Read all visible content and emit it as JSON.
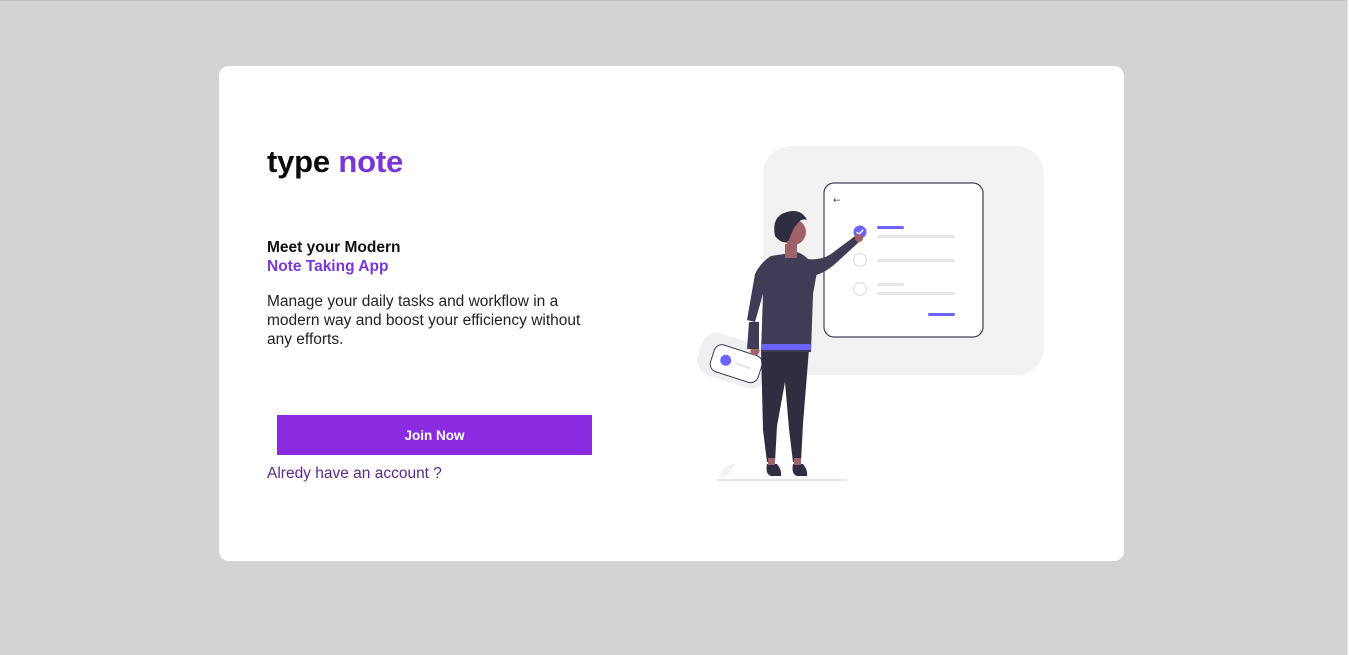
{
  "brand": {
    "word1": "type",
    "word2": "note"
  },
  "hero": {
    "headline_line1": "Meet your Modern",
    "headline_line2": "Note Taking App",
    "description": "Manage your daily tasks and workflow in a modern way and boost your efficiency without any efforts."
  },
  "actions": {
    "join_label": "Join Now",
    "account_link": "Alredy have an account ?"
  },
  "illustration": {
    "icon": "person-checking-tasks-illustration"
  },
  "colors": {
    "brand_accent": "#7b35d6",
    "button_bg": "#8a2be2",
    "link_color": "#5a2a8a",
    "page_bg": "#d3d3d3",
    "illustration_accent": "#6c63ff"
  }
}
